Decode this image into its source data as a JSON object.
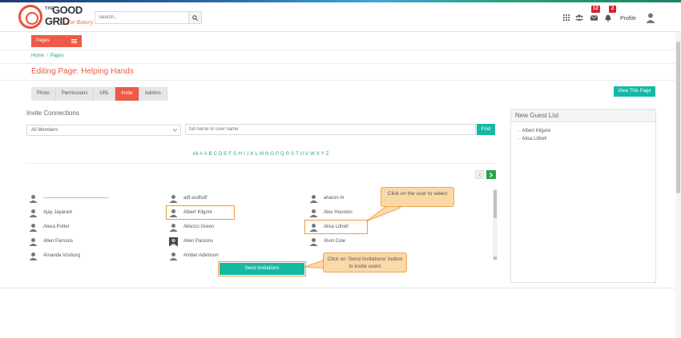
{
  "header": {
    "logo": {
      "the": "THE",
      "good": "GOOD",
      "grid": "GRID",
      "tagline": "for Rotary"
    },
    "search_placeholder": "Search...",
    "icons": [
      "apps-grid-icon",
      "users-icon",
      "mail-icon",
      "bell-icon",
      "search-icon"
    ],
    "mail_badge": "12",
    "bell_badge": "2",
    "profile_label": "Profile"
  },
  "pages_menu": {
    "label": "Pages"
  },
  "breadcrumb": {
    "home": "Home",
    "separator": "/",
    "current": "Pages"
  },
  "page_title": "Editing Page: Helping Hands",
  "tabs": [
    {
      "label": "Photo",
      "active": false
    },
    {
      "label": "Permissions",
      "active": false
    },
    {
      "label": "URL",
      "active": false
    },
    {
      "label": "Invite",
      "active": true
    },
    {
      "label": "Admins",
      "active": false
    }
  ],
  "view_page_button": "View This Page",
  "invite": {
    "title": "Invite Connections",
    "member_filter": "All Members",
    "name_placeholder": "full name or user name",
    "find_button": "Find",
    "alphabet": [
      "All",
      "#",
      "A",
      "B",
      "C",
      "D",
      "E",
      "F",
      "G",
      "H",
      "I",
      "J",
      "K",
      "L",
      "M",
      "N",
      "O",
      "P",
      "Q",
      "R",
      "S",
      "T",
      "U",
      "V",
      "W",
      "X",
      "Y",
      "Z"
    ],
    "contacts_col1": [
      "-----------------------------------------",
      "Ajay Jayaram",
      "Alexa Potter",
      "Allen Parsons",
      "Amanda Vosburg"
    ],
    "contacts_col2": [
      "adf asdfsdf",
      "Albert Kilgore",
      "Allonzo Green",
      "Allen Parsons",
      "Amber Adkinson"
    ],
    "contacts_col3": [
      "aharon m",
      "Alex Houston",
      "Alisa Littrell",
      "Alvin Cole"
    ],
    "send_button": "Send Invitations"
  },
  "callouts": {
    "select_user": "Click on the user to select",
    "send_invites": "Click on 'Send Invitations' button to invite users"
  },
  "guest_list": {
    "title": "New Guest List",
    "guests": [
      "Albert Kilgore",
      "Alisa Littrell"
    ]
  },
  "colors": {
    "accent": "#ed5a46",
    "teal": "#14b9a4",
    "highlight": "#f09a3e",
    "callout": "#fbd9a7"
  }
}
